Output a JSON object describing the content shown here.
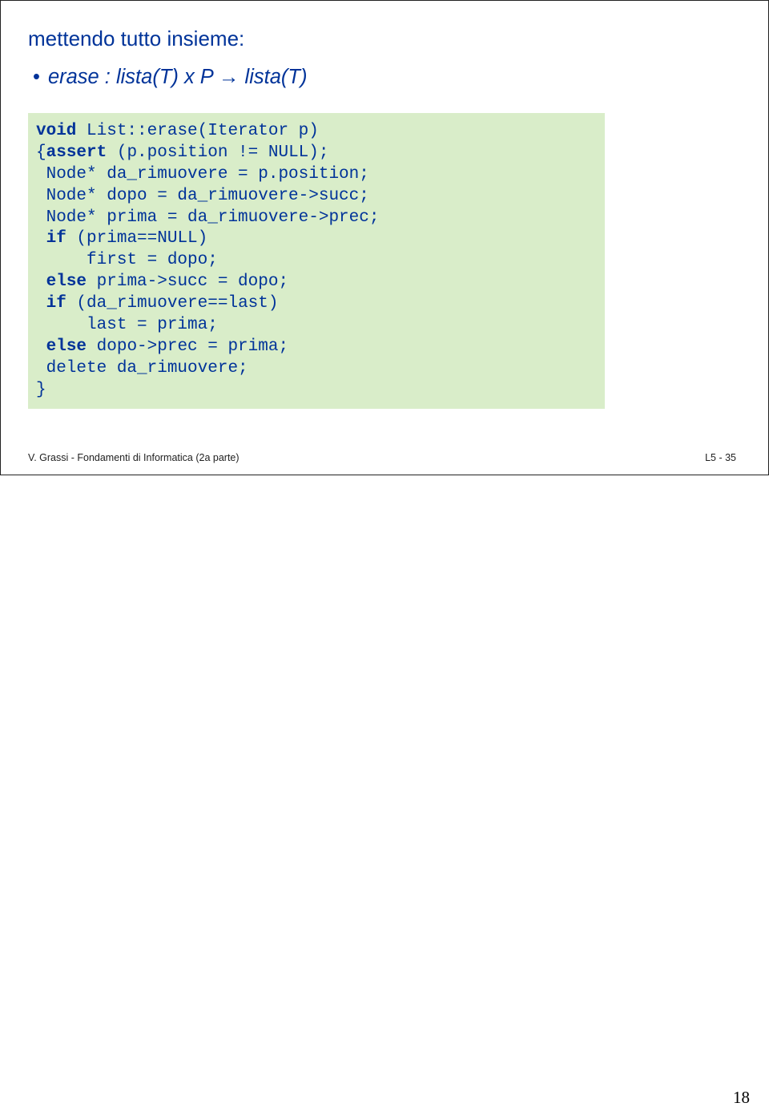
{
  "slide": {
    "title": "mettendo tutto insieme:",
    "erase_bullet": "•",
    "erase_text": "erase : lista(T) x P → lista(T)",
    "code": {
      "l1_kw": "void",
      "l1_rest": " List::erase(Iterator p)",
      "l2a": "{",
      "l2_kw": "assert",
      "l2b": " (p.position != NULL);",
      "l3": " Node* da_rimuovere = p.position;",
      "l4": " Node* dopo = da_rimuovere->succ;",
      "l5": " Node* prima = da_rimuovere->prec;",
      "l6_pre": " ",
      "l6_kw": "if",
      "l6_rest": " (prima==NULL)",
      "l7": "     first = dopo;",
      "l8_pre": " ",
      "l8_kw": "else",
      "l8_rest": " prima->succ = dopo;",
      "l9_pre": " ",
      "l9_kw": "if",
      "l9_rest": " (da_rimuovere==last)",
      "l10": "     last = prima;",
      "l11_pre": " ",
      "l11_kw": "else",
      "l11_rest": " dopo->prec = prima;",
      "l12": " delete da_rimuovere;",
      "l13": "}"
    },
    "footer_left": "V. Grassi - Fondamenti di Informatica (2a parte)",
    "footer_right": "L5 - 35"
  },
  "page_number": "18"
}
